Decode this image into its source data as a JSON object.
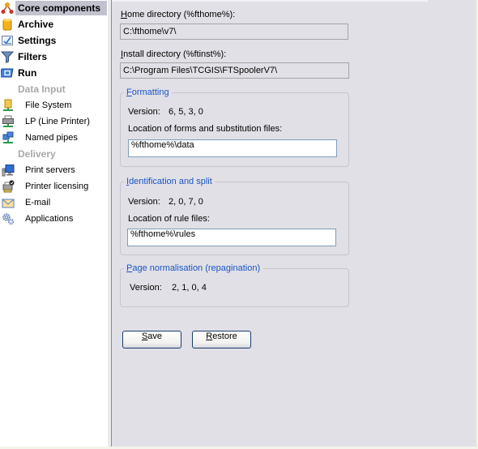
{
  "sidebar": {
    "items": [
      {
        "label": "Core components",
        "icon": "hierarchy-icon",
        "selected": true
      },
      {
        "label": "Archive",
        "icon": "archive-cylinder-icon"
      },
      {
        "label": "Settings",
        "icon": "settings-checkbox-icon"
      },
      {
        "label": "Filters",
        "icon": "filter-funnel-icon"
      },
      {
        "label": "Run",
        "icon": "run-icon"
      }
    ],
    "groups": [
      {
        "label": "Data Input",
        "items": [
          {
            "label": "File System",
            "icon": "network-folder-icon"
          },
          {
            "label": "LP (Line Printer)",
            "icon": "network-printer-icon"
          },
          {
            "label": "Named pipes",
            "icon": "network-pipes-icon"
          }
        ]
      },
      {
        "label": "Delivery",
        "items": [
          {
            "label": "Print servers",
            "icon": "print-server-icon"
          },
          {
            "label": "Printer licensing",
            "icon": "printer-license-icon"
          },
          {
            "label": "E-mail",
            "icon": "email-envelope-icon"
          },
          {
            "label": "Applications",
            "icon": "applications-gear-icon"
          }
        ]
      }
    ]
  },
  "main": {
    "home_dir": {
      "label_u": "H",
      "label_rest": "ome directory (%fthome%):",
      "value": "C:\\fthome\\v7\\"
    },
    "install_dir": {
      "label_u": "I",
      "label_rest": "nstall directory (%ftinst%):",
      "value": "C:\\Program Files\\TCGIS\\FTSpoolerV7\\"
    },
    "formatting": {
      "title_u": "F",
      "title_rest": "ormatting",
      "version_label": "Version:",
      "version": "6, 5, 3, 0",
      "location_label": "Location of forms and substitution files:",
      "location_value": "%fthome%\\data"
    },
    "identification": {
      "title_u": "I",
      "title_rest": "dentification and split",
      "version_label": "Version:",
      "version": "2, 0, 7, 0",
      "location_label": "Location of rule files:",
      "location_value": "%fthome%\\rules"
    },
    "normalisation": {
      "title_u": "P",
      "title_rest": "age normalisation (repagination)",
      "version_label": "Version:",
      "version": "2, 1, 0, 4"
    },
    "buttons": {
      "save_u": "S",
      "save_rest": "ave",
      "restore_u": "R",
      "restore_rest": "estore"
    }
  }
}
